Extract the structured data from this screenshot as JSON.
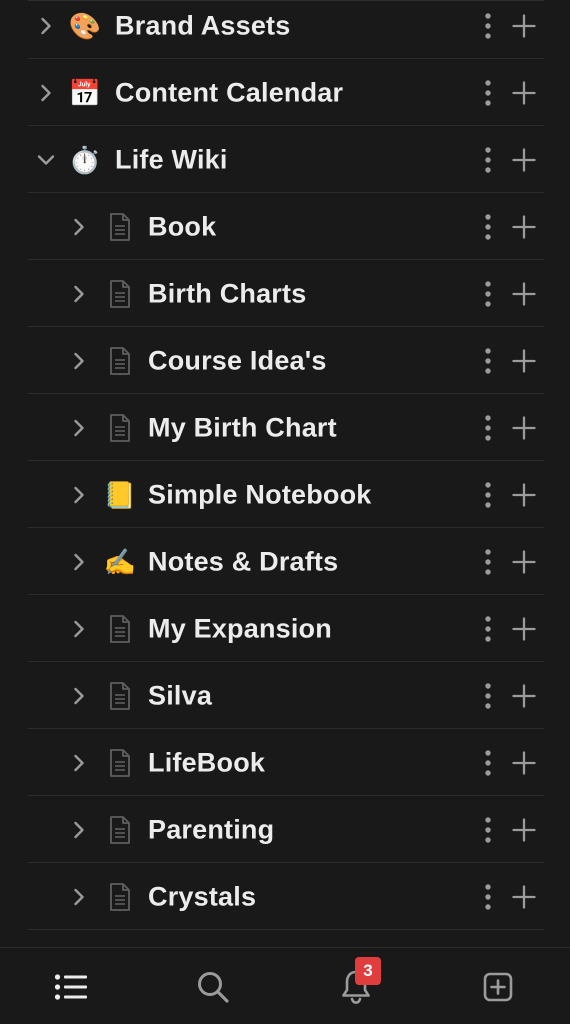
{
  "colors": {
    "background": "#191919",
    "text": "#ececec",
    "icon_muted": "#9b9b9b",
    "divider": "#2c2c2c",
    "badge": "#e03e3e"
  },
  "tree": [
    {
      "label": "Brand Assets",
      "level": 0,
      "expanded": false,
      "icon": "artist-palette-emoji",
      "glyph": "🎨"
    },
    {
      "label": "Content Calendar",
      "level": 0,
      "expanded": false,
      "icon": "calendar-emoji",
      "glyph": "📅"
    },
    {
      "label": "Life Wiki",
      "level": 0,
      "expanded": true,
      "icon": "stopwatch-emoji",
      "glyph": "⏱️"
    },
    {
      "label": "Book",
      "level": 1,
      "expanded": false,
      "icon": "page-icon"
    },
    {
      "label": "Birth Charts",
      "level": 1,
      "expanded": false,
      "icon": "page-icon"
    },
    {
      "label": "Course Idea's",
      "level": 1,
      "expanded": false,
      "icon": "page-icon"
    },
    {
      "label": "My Birth Chart",
      "level": 1,
      "expanded": false,
      "icon": "page-icon"
    },
    {
      "label": "Simple Notebook",
      "level": 1,
      "expanded": false,
      "icon": "notebook-emoji",
      "glyph": "📒"
    },
    {
      "label": "Notes & Drafts",
      "level": 1,
      "expanded": false,
      "icon": "writing-hand-emoji",
      "glyph": "✍️"
    },
    {
      "label": "My Expansion",
      "level": 1,
      "expanded": false,
      "icon": "page-icon"
    },
    {
      "label": "Silva",
      "level": 1,
      "expanded": false,
      "icon": "page-icon"
    },
    {
      "label": "LifeBook",
      "level": 1,
      "expanded": false,
      "icon": "page-icon"
    },
    {
      "label": "Parenting",
      "level": 1,
      "expanded": false,
      "icon": "page-icon"
    },
    {
      "label": "Crystals",
      "level": 1,
      "expanded": false,
      "icon": "page-icon"
    }
  ],
  "bottom_nav": {
    "items": [
      {
        "name": "home-list",
        "icon": "list-icon"
      },
      {
        "name": "search",
        "icon": "search-icon"
      },
      {
        "name": "inbox",
        "icon": "bell-icon"
      },
      {
        "name": "new-page",
        "icon": "new-page-icon"
      }
    ],
    "inbox_badge": "3"
  }
}
